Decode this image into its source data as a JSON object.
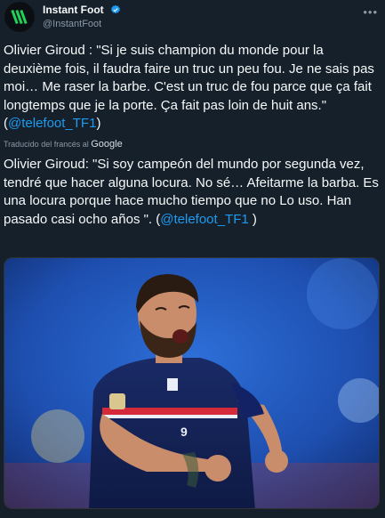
{
  "account": {
    "display_name": "Instant Foot",
    "handle": "@InstantFoot",
    "verified_icon": "verified-badge-icon",
    "avatar_icon": "soccer-ball-logo-icon"
  },
  "tweet": {
    "text": "Olivier Giroud : \"Si je suis champion du monde pour la deuxième fois, il faudra faire un truc un peu fou. Je ne sais pas moi… Me raser la barbe. C'est un truc de fou parce que ça fait longtemps que je la porte. Ça fait pas loin de huit ans.\" (",
    "mention": "@telefoot_TF1",
    "text_end": ")"
  },
  "translation": {
    "label": "Traducido del francés al",
    "provider": "Google",
    "text": "Olivier Giroud: \"Si soy campeón del mundo por segunda vez, tendré que hacer alguna locura. No sé… Afeitarme la barba. Es una locura porque hace mucho tiempo que no Lo uso. Han pasado casi ocho años \". (",
    "mention": "@telefoot_TF1",
    "text_end": " )"
  },
  "media": {
    "description_icon": "photo-player-celebrating",
    "jersey_number": "9"
  },
  "colors": {
    "background": "#15202b",
    "link": "#1d9bf0",
    "secondary_text": "#8b98a5",
    "verified": "#1d9bf0"
  }
}
